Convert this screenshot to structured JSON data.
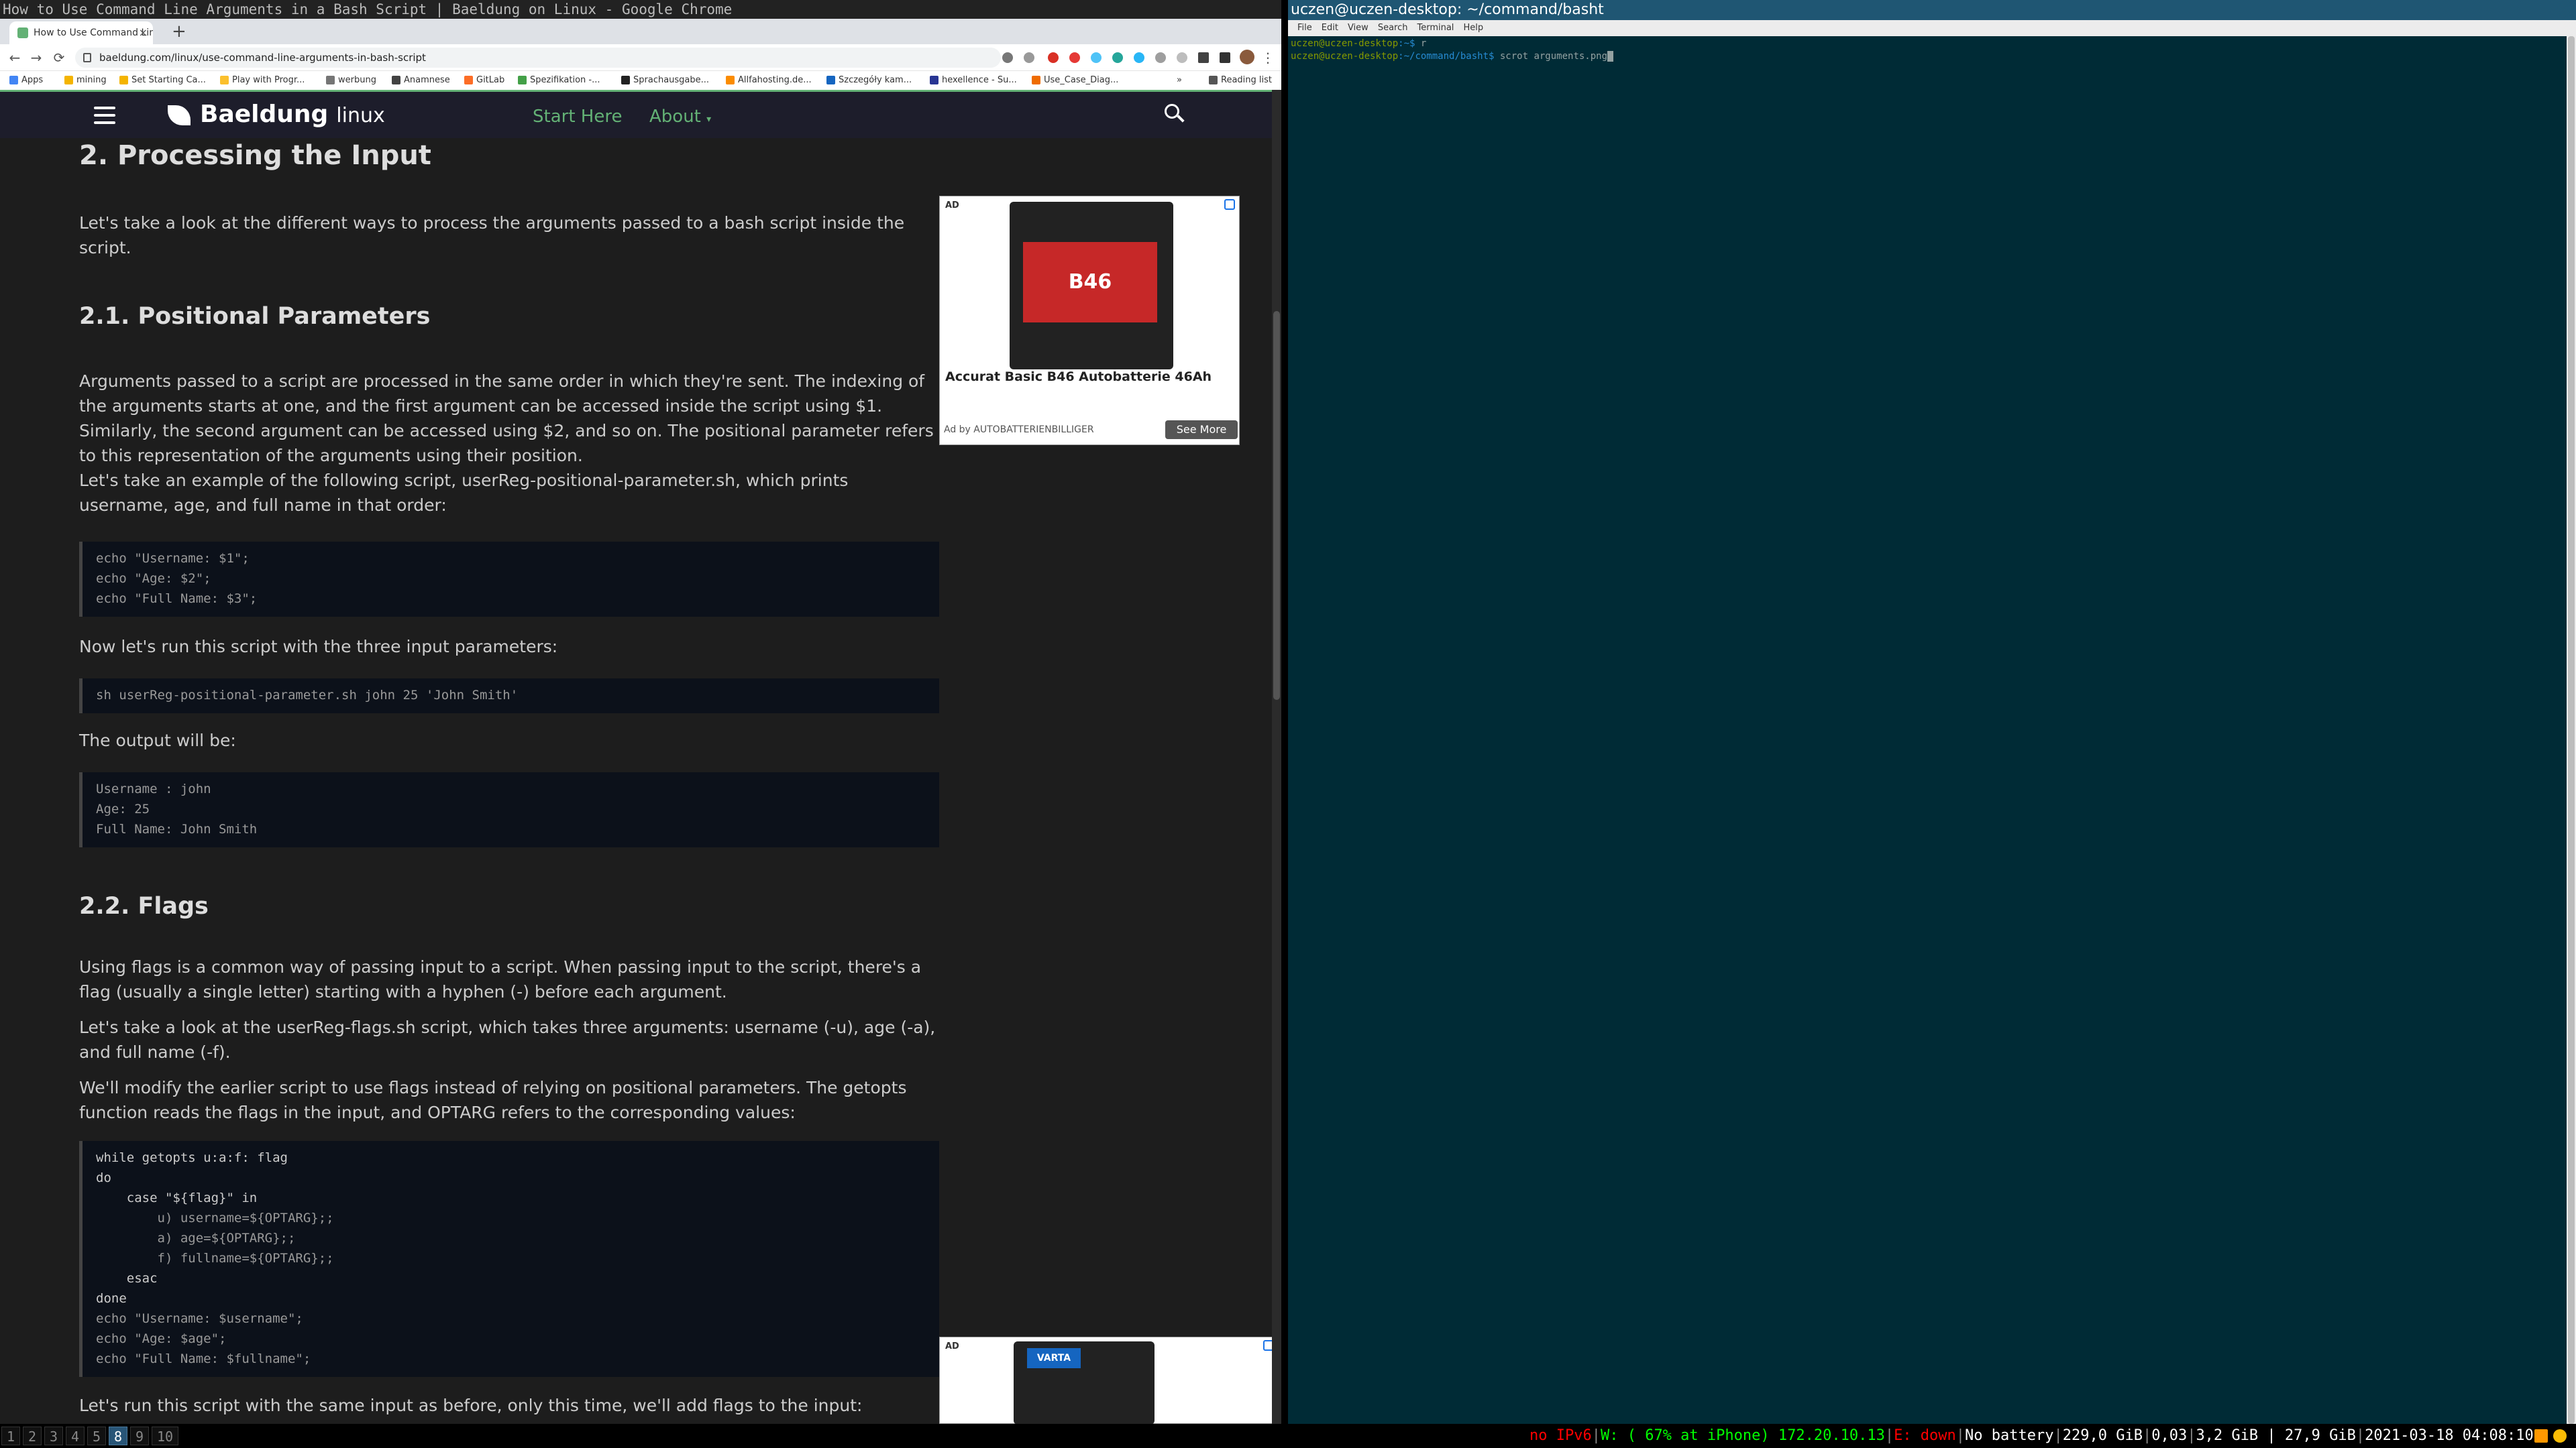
{
  "browser": {
    "window_title": "How to Use Command Line Arguments in a Bash Script | Baeldung on Linux - Google Chrome",
    "tab_title": "How to Use Command Lin",
    "tab_close": "×",
    "new_tab": "+",
    "back": "←",
    "forward": "→",
    "reload": "⟳",
    "url": "baeldung.com/linux/use-command-line-arguments-in-bash-script",
    "menu_dots": "⋮",
    "bookmarks": [
      "Apps",
      "mining",
      "Set Starting Ca...",
      "Play with Progr...",
      "werbung",
      "Anamnese",
      "GitLab",
      "Spezifikation -...",
      "Sprachausgabe...",
      "Allfahosting.de...",
      "Szczegóły kam...",
      "hexellence - Su...",
      "Use_Case_Diag..."
    ],
    "bookmarks_more": "»",
    "reading_list": "Reading list"
  },
  "site": {
    "logo": "Baeldung",
    "logo_sub": "linux",
    "nav": [
      "Start Here",
      "About"
    ],
    "about_caret": "▾"
  },
  "article": {
    "h2": "2. Processing the Input",
    "intro": "Let's take a look at the different ways to process the arguments passed to a bash script inside the script.",
    "h3_positional": "2.1. Positional Parameters",
    "p_positional_1": "Arguments passed to a script are processed in the same order in which they're sent. The indexing of the arguments starts at one, and the first argument can be accessed inside the script using $1. Similarly, the second argument can be accessed using $2, and so on. The positional parameter refers to this representation of the arguments using their position.",
    "p_positional_2": "Let's take an example of the following script, userReg-positional-parameter.sh, which prints username, age, and full name in that order:",
    "code1": "echo \"Username: $1\";\necho \"Age: $2\";\necho \"Full Name: $3\";",
    "p_run": "Now let's run this script with the three input parameters:",
    "code2": "sh userReg-positional-parameter.sh john 25 'John Smith'",
    "p_output": "The output will be:",
    "code3": "Username : john\nAge: 25\nFull Name: John Smith",
    "h3_flags": "2.2. Flags",
    "p_flags_1": "Using flags is a common way of passing input to a script. When passing input to the script, there's a flag (usually a single letter) starting with a hyphen (-) before each argument.",
    "p_flags_2": "Let's take a look at the userReg-flags.sh script, which takes three arguments: username (-u), age (-a), and full name (-f).",
    "p_flags_3": "We'll modify the earlier script to use flags instead of relying on positional parameters. The getopts function reads the flags in the input, and OPTARG refers to the corresponding values:",
    "code4_lines": [
      "while getopts u:a:f: flag",
      "do",
      "    case \"${flag}\" in",
      "        u) username=${OPTARG};;",
      "        a) age=${OPTARG};;",
      "        f) fullname=${OPTARG};;",
      "    esac",
      "done",
      "echo \"Username: $username\";",
      "echo \"Age: $age\";",
      "echo \"Full Name: $fullname\";"
    ],
    "p_last": "Let's run this script with the same input as before, only this time, we'll add flags to the input:"
  },
  "ad1": {
    "label": "AD",
    "product_badge": "B46",
    "title": "Accurat Basic B46 Autobatterie 46Ah",
    "by": "Ad by AUTOBATTERIENBILLIGER",
    "button": "See More"
  },
  "ad2": {
    "label": "AD",
    "brand": "VARTA"
  },
  "terminal": {
    "title": "uczen@uczen-desktop: ~/command/basht",
    "menu": [
      "File",
      "Edit",
      "View",
      "Search",
      "Terminal",
      "Help"
    ],
    "line1_user": "uczen@uczen-desktop",
    "line1_path": ":~$ ",
    "line1_cmd": "r",
    "line2_user": "uczen@uczen-desktop",
    "line2_path": ":~/command/basht$ ",
    "line2_cmd": "scrot arguments.png"
  },
  "statusbar": {
    "workspaces": [
      "1",
      "2",
      "3",
      "4",
      "5",
      "8",
      "9",
      "10"
    ],
    "active_workspace": "8",
    "ipv6": "no IPv6",
    "wifi": "W: ( 67% at iPhone) 172.20.10.13",
    "eth": "E: down",
    "battery": "No battery",
    "disk": "229,0 GiB",
    "load": "0,03",
    "mem": "3,2 GiB | 27,9 GiB",
    "datetime": "2021-03-18 04:08:10",
    "sep": "|"
  },
  "colors": {
    "accent": "#63b175",
    "terminal_bg": "#002b36",
    "active_workspace": "#285577"
  }
}
